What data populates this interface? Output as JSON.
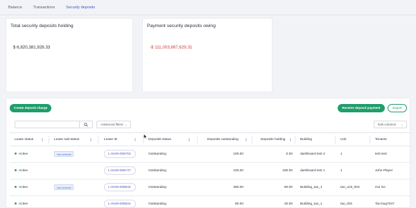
{
  "tabs": [
    {
      "label": "Balance",
      "active": false
    },
    {
      "label": "Transactions",
      "active": false
    },
    {
      "label": "Security deposits",
      "active": true
    }
  ],
  "summary": {
    "holding": {
      "title": "Total security deposits holding",
      "value": "$ 6,820,381,928.33"
    },
    "owing": {
      "title": "Payment security deposits owing",
      "value": "-$ 111,003,867,629.31"
    }
  },
  "toolbar": {
    "create_label": "Create deposit charge",
    "receive_label": "Receive deposit payment",
    "export_label": "Export",
    "search_placeholder": "",
    "filters_label": "Advanced filters",
    "edit_columns_label": "Edit columns"
  },
  "table": {
    "columns": [
      "Lease status",
      "Lease sub-status",
      "Lease ID",
      "Deposits status",
      "Deposits outstanding",
      "Deposits holding",
      "Building",
      "Unit",
      "Tenants"
    ],
    "rows": [
      {
        "status": "Active",
        "sub_status": "Non-renewal",
        "lease_id": "L-0449-085753",
        "deposit_status": "Outstanding",
        "outstanding": "100.00",
        "holding": "0.00",
        "building": "dashboard test 2",
        "unit": "1",
        "tenants": "test test"
      },
      {
        "status": "Active",
        "sub_status": "",
        "lease_id": "L-0449-085747",
        "deposit_status": "Outstanding",
        "outstanding": "100.00",
        "holding": "180.00",
        "building": "dashboard test 1",
        "unit": "1",
        "tenants": "John Player"
      },
      {
        "status": "Active",
        "sub_status": "Non-renewal",
        "lease_id": "L-0449-085834",
        "deposit_status": "Outstanding",
        "outstanding": "450.00",
        "holding": "80.00",
        "building": "Building_tao_1",
        "unit": "tao_unit_004",
        "tenants": "Hui Ge"
      },
      {
        "status": "Active",
        "sub_status": "",
        "lease_id": "L-0449-085824",
        "deposit_status": "Outstanding",
        "outstanding": "80.00",
        "holding": "20.00",
        "building": "Building_tao_1",
        "unit": "tao_001",
        "tenants": "Tao bug7047"
      }
    ]
  },
  "colors": {
    "accent": "#4a55c8",
    "green": "#1f9d6b",
    "negative": "#d93a3a",
    "active_dot": "#2fa36b"
  }
}
